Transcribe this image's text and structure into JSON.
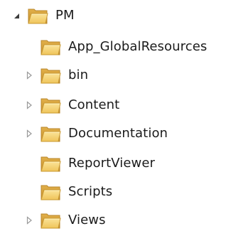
{
  "tree": {
    "root": {
      "label": "PM",
      "expanded": true,
      "icon": "folder-icon"
    },
    "children": [
      {
        "label": "App_GlobalResources",
        "has_children": false,
        "icon": "folder-icon"
      },
      {
        "label": "bin",
        "has_children": true,
        "expanded": false,
        "icon": "folder-icon"
      },
      {
        "label": "Content",
        "has_children": true,
        "expanded": false,
        "icon": "folder-icon"
      },
      {
        "label": "Documentation",
        "has_children": true,
        "expanded": false,
        "icon": "folder-icon"
      },
      {
        "label": "ReportViewer",
        "has_children": false,
        "icon": "folder-icon"
      },
      {
        "label": "Scripts",
        "has_children": false,
        "icon": "folder-icon"
      },
      {
        "label": "Views",
        "has_children": true,
        "expanded": false,
        "icon": "folder-icon"
      }
    ]
  },
  "colors": {
    "folder_back": "#d9a63c",
    "folder_front": "#f7d77a",
    "folder_edge": "#b8862a",
    "expander_open": "#3c3c3c",
    "expander_closed": "#9a9a9a"
  }
}
